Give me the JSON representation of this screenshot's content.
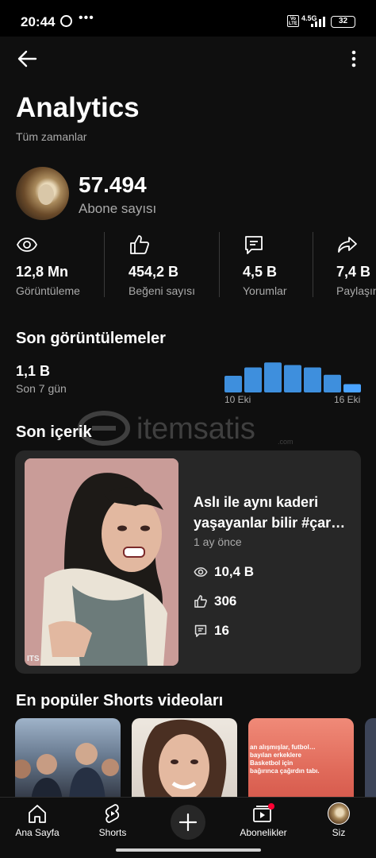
{
  "status_bar": {
    "time": "20:44",
    "dots": "•••",
    "volte": "Vo LTE",
    "network": "4.5G",
    "battery": "32"
  },
  "header": {
    "title": "Analytics",
    "subtitle": "Tüm zamanlar"
  },
  "channel": {
    "subscribers": "57.494",
    "subscribers_label": "Abone sayısı"
  },
  "stats": [
    {
      "icon": "eye-icon",
      "value": "12,8 Mn",
      "label": "Görüntüleme"
    },
    {
      "icon": "like-icon",
      "value": "454,2 B",
      "label": "Beğeni sayısı"
    },
    {
      "icon": "comment-icon",
      "value": "4,5 B",
      "label": "Yorumlar"
    },
    {
      "icon": "share-icon",
      "value": "7,4 B",
      "label": "Paylaşım"
    }
  ],
  "recent_views": {
    "title": "Son görüntülemeler",
    "value": "1,1 B",
    "label": "Son 7 gün",
    "axis_start": "10 Eki",
    "axis_end": "16 Eki",
    "bars": [
      0.5,
      0.75,
      0.9,
      0.82,
      0.75,
      0.53,
      0.25
    ],
    "bar_color": "#3e8fdd",
    "highlight_color": "#4aa3ff"
  },
  "recent_content": {
    "title": "Son içerik",
    "video_title": "Aslı ile aynı kaderi yaşayanlar bilir #çar…",
    "age": "1 ay önce",
    "views": "10,4 B",
    "likes": "306",
    "comments": "16",
    "thumb_corner": "ITS"
  },
  "watermark": {
    "text": "itemsatis",
    "suffix": ".com"
  },
  "popular_shorts": {
    "title": "En popüler Shorts videoları",
    "short3_caption": "an alışmışlar, futbol… bayılan erkeklere Basketbol için bağırınca çağırdın tabı."
  },
  "bottom_nav": [
    {
      "icon": "home-icon",
      "label": "Ana Sayfa"
    },
    {
      "icon": "shorts-icon",
      "label": "Shorts"
    },
    {
      "icon": "plus-icon",
      "label": ""
    },
    {
      "icon": "subscriptions-icon",
      "label": "Abonelikler"
    },
    {
      "icon": "profile-avatar",
      "label": "Siz"
    }
  ]
}
